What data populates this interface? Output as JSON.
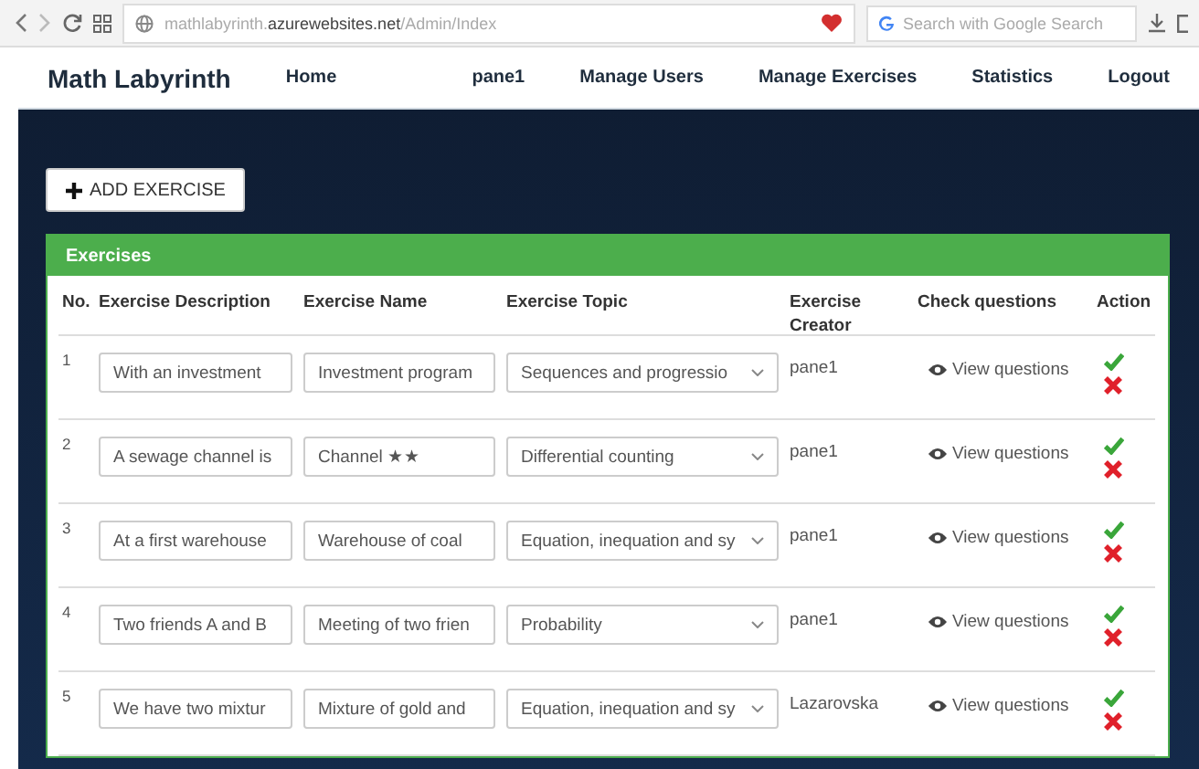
{
  "browser": {
    "url": "mathlabyrinth.**azurewebsites.net**/Admin/Index",
    "search_placeholder": "Search with Google Search"
  },
  "navbar": {
    "brand": "Math Labyrinth",
    "left_links": [
      "Home"
    ],
    "right_links": [
      "pane1",
      "Manage Users",
      "Manage Exercises",
      "Statistics",
      "Logout"
    ]
  },
  "add_button": "ADD EXERCISE",
  "panel": {
    "title": "Exercises",
    "columns": [
      "No.",
      "Exercise Description",
      "Exercise Name",
      "Exercise Topic",
      "Exercise Creator",
      "Check questions",
      "Action"
    ],
    "rows": [
      {
        "no": "1",
        "description": "With an investment",
        "name": "Investment program",
        "topic": "Sequences and progressio",
        "creator": "pane1",
        "link": "View questions"
      },
      {
        "no": "2",
        "description": "A sewage channel is",
        "name": "Channel ★★",
        "topic": "Differential counting",
        "creator": "pane1",
        "link": "View questions"
      },
      {
        "no": "3",
        "description": "At a first warehouse",
        "name": "Warehouse of coal",
        "topic": "Equation, inequation and sy",
        "creator": "pane1",
        "link": "View questions"
      },
      {
        "no": "4",
        "description": "Two friends A and B",
        "name": "Meeting of two frien",
        "topic": "Probability",
        "creator": "pane1",
        "link": "View questions"
      },
      {
        "no": "5",
        "description": "We have two mixtur",
        "name": "Mixture of gold and",
        "topic": "Equation, inequation and sy",
        "creator": "Lazarovska",
        "link": "View questions"
      }
    ]
  }
}
